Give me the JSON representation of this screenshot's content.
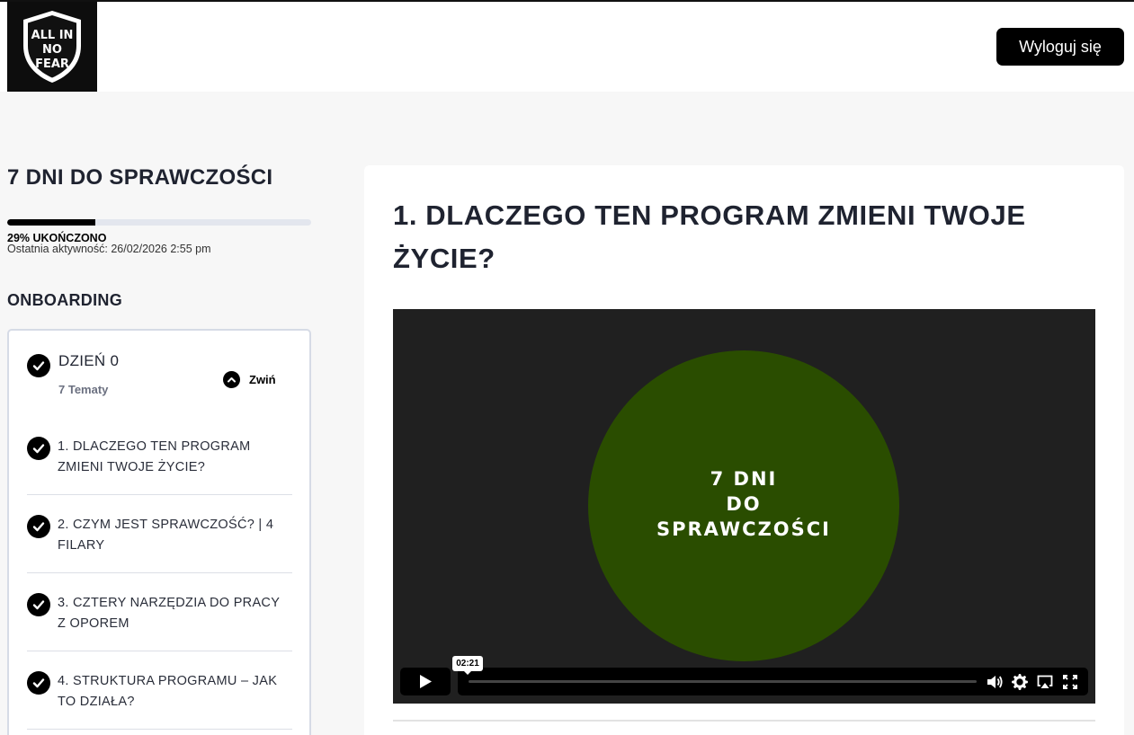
{
  "header": {
    "logo_text": "ALL IN NO FEAR",
    "logout_label": "Wyloguj się"
  },
  "sidebar": {
    "course_title": "7 DNI DO SPRAWCZOŚCI",
    "progress": {
      "percent": 29,
      "label": "29% UKOŃCZONO",
      "last_activity": "Ostatnia aktywność: 26/02/2026 2:55 pm"
    },
    "section_title": "ONBOARDING",
    "day": {
      "title": "DZIEŃ 0",
      "topics_count": "7 Tematy",
      "collapse_label": "Zwiń",
      "topics": [
        {
          "label": "1. DLACZEGO TEN PROGRAM ZMIENI TWOJE ŻYCIE?",
          "completed": true
        },
        {
          "label": "2. CZYM JEST SPRAWCZOŚĆ? | 4 FILARY",
          "completed": true
        },
        {
          "label": "3. CZTERY NARZĘDZIA DO PRACY Z OPOREM",
          "completed": true
        },
        {
          "label": "4. STRUKTURA PROGRAMU – JAK TO DZIAŁA?",
          "completed": true
        }
      ]
    }
  },
  "main": {
    "lesson_title": "1. DLACZEGO TEN PROGRAM ZMIENI TWOJE ŻYCIE?",
    "video": {
      "overlay_line1": "7 DNI",
      "overlay_line2": "DO",
      "overlay_line3": "SPRAWCZOŚCI",
      "time_tooltip": "02:21",
      "circle_color": "#2a4d00"
    }
  }
}
